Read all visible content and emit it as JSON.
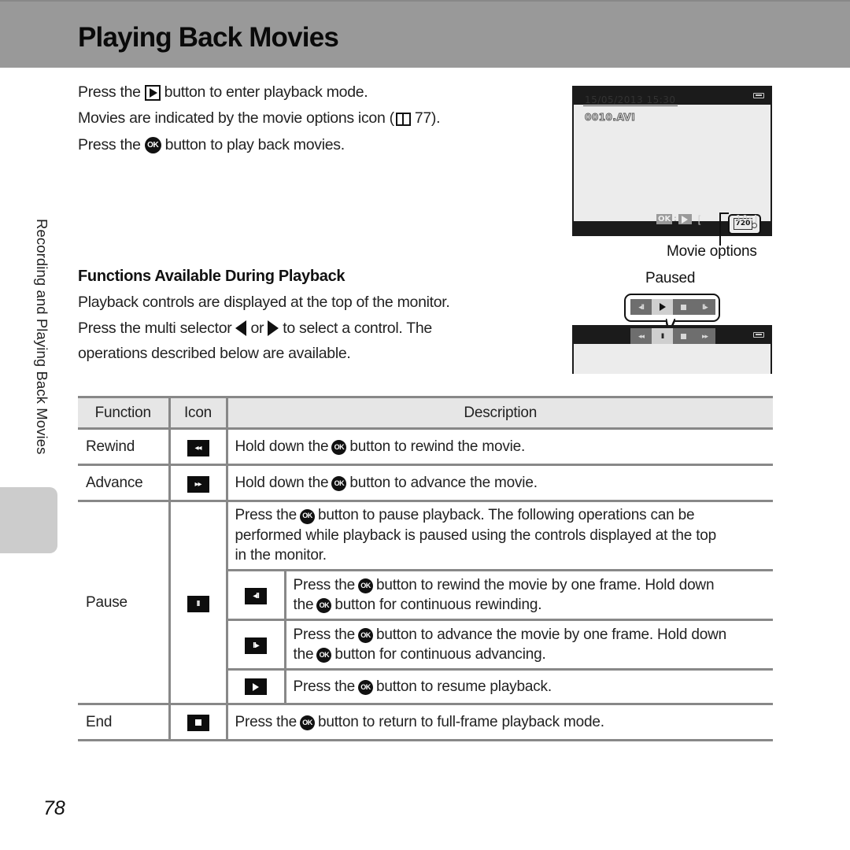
{
  "header": {
    "title": "Playing Back Movies"
  },
  "side_tab": {
    "label": "Recording and Playing Back Movies"
  },
  "intro": {
    "line1": {
      "before": "Press the",
      "icon": "playback-button-icon",
      "after": "button to enter playback mode."
    },
    "line2": {
      "before": "Movies are indicated by the movie options icon (",
      "icon": "book-reference-icon",
      "after": "77)."
    },
    "line3": {
      "before": "Press the",
      "icon": "ok-button-icon",
      "after": "button to play back movies."
    }
  },
  "section": {
    "heading": "Functions Available During Playback",
    "line1": "Playback controls are displayed at the top of the monitor.",
    "line2": {
      "before": "Press the multi selector",
      "or": "or",
      "after": "to select a control. The"
    },
    "line3": "operations described below are available."
  },
  "screen1": {
    "datetime": "15/05/2013  15:30",
    "filename": "0010.AVI",
    "ok_label": "OK",
    "colon": ":",
    "bracket": "[",
    "duration": "10s]",
    "resolution": "720",
    "callout": "Movie options"
  },
  "screen2": {
    "callout": "Paused",
    "bubble_controls": [
      {
        "name": "frame-rewind",
        "glyph": "◂II",
        "selected": false
      },
      {
        "name": "play",
        "glyph": "play",
        "selected": true
      },
      {
        "name": "end",
        "glyph": "stop",
        "selected": false
      },
      {
        "name": "frame-advance",
        "glyph": "II▸",
        "selected": false
      }
    ],
    "bar_controls": [
      {
        "name": "rewind",
        "glyph": "◂◂",
        "selected": false
      },
      {
        "name": "pause",
        "glyph": "II",
        "selected": true
      },
      {
        "name": "end",
        "glyph": "stop",
        "selected": false
      },
      {
        "name": "advance",
        "glyph": "▸▸",
        "selected": false
      }
    ]
  },
  "table": {
    "headers": {
      "function": "Function",
      "icon": "Icon",
      "description": "Description"
    },
    "ok": "OK",
    "rows": {
      "rewind": {
        "function": "Rewind",
        "icon_glyph": "◂◂",
        "desc_before": "Hold down the",
        "desc_after": "button to rewind the movie."
      },
      "advance": {
        "function": "Advance",
        "icon_glyph": "▸▸",
        "desc_before": "Hold down the",
        "desc_after": "button to advance the movie."
      },
      "pause": {
        "function": "Pause",
        "icon_glyph": "II",
        "desc_line1_before": "Press the",
        "desc_line1_after": "button to pause playback. The following operations can be",
        "desc_line2": "performed while playback is paused using the controls displayed at the top",
        "desc_line3": "in the monitor.",
        "sub": {
          "frame_rewind": {
            "icon_glyph": "◂II",
            "l1_before": "Press the",
            "l1_after": "button to rewind the movie by one frame. Hold down",
            "l2_before": "the",
            "l2_after": "button for continuous rewinding."
          },
          "frame_advance": {
            "icon_glyph": "II▸",
            "l1_before": "Press the",
            "l1_after": "button to advance the movie by one frame. Hold down",
            "l2_before": "the",
            "l2_after": "button for continuous advancing."
          },
          "resume": {
            "l1_before": "Press the",
            "l1_after": "button to resume playback."
          }
        }
      },
      "end": {
        "function": "End",
        "desc_before": "Press the",
        "desc_after": "button to return to full-frame playback mode."
      }
    }
  },
  "page_number": "78"
}
